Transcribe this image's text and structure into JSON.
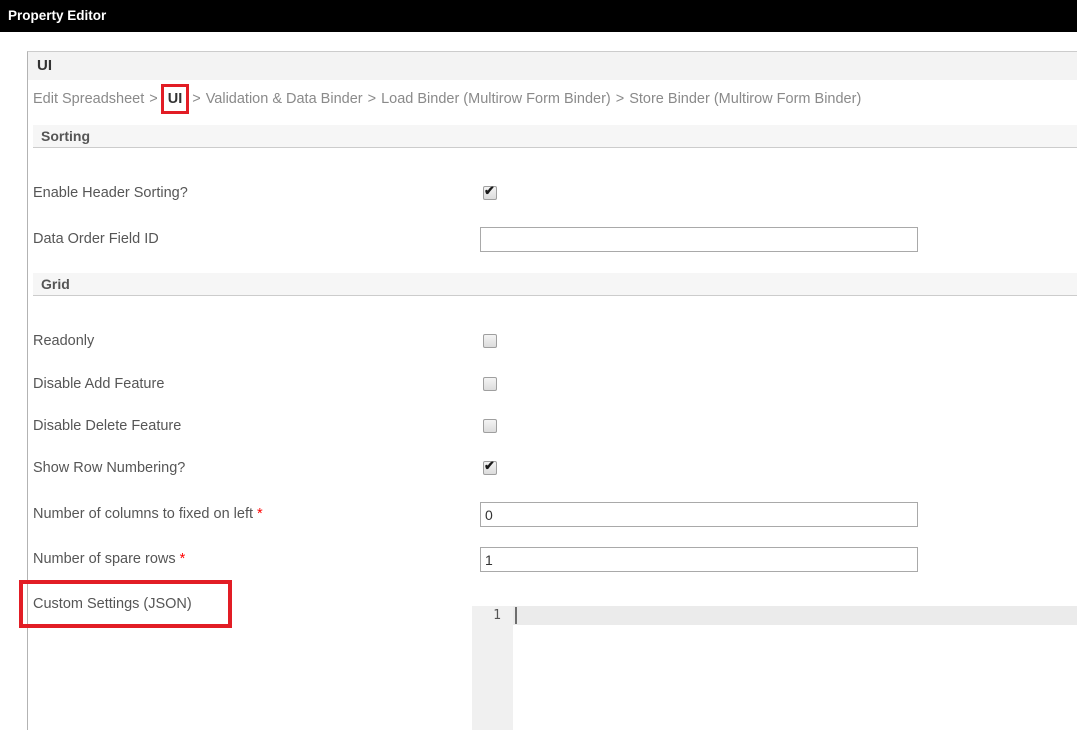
{
  "colors": {
    "titlebar_bg": "#000000",
    "titlebar_text": "#ffffff",
    "annotation_red": "#e21d25",
    "section_band_bg": "#f6f6f6",
    "panel_header_bg": "#f3f3f3",
    "label_text": "#565656",
    "breadcrumb_text": "#8a8a8a",
    "required_marker_red": "#ff0000",
    "editor_gutter_bg": "#f0f0f0",
    "editor_activeline_bg": "#ebebeb"
  },
  "titlebar": {
    "title": "Property Editor"
  },
  "panel": {
    "title": "UI"
  },
  "breadcrumb": {
    "separator": ">",
    "items": [
      "Edit Spreadsheet",
      "UI",
      "Validation & Data Binder",
      "Load Binder (Multirow Form Binder)",
      "Store Binder (Multirow Form Binder)"
    ],
    "current": "UI"
  },
  "form": {
    "required_marker": "*",
    "sections": [
      {
        "title": "Sorting"
      },
      {
        "title": "Grid"
      }
    ],
    "rows": [
      {
        "label": "Enable Header Sorting?",
        "type": "checkbox",
        "checked": true
      },
      {
        "label": "Data Order Field ID",
        "type": "text",
        "value": ""
      },
      {
        "label": "Readonly",
        "type": "checkbox",
        "checked": false
      },
      {
        "label": "Disable Add Feature",
        "type": "checkbox",
        "checked": false
      },
      {
        "label": "Disable Delete Feature",
        "type": "checkbox",
        "checked": false
      },
      {
        "label": "Show Row Numbering?",
        "type": "checkbox",
        "checked": true
      },
      {
        "label": "Number of columns to fixed on left",
        "required": true,
        "type": "text",
        "value": "0"
      },
      {
        "label": "Number of spare rows",
        "required": true,
        "type": "text",
        "value": "1"
      },
      {
        "label": "Custom Settings (JSON)",
        "type": "code_editor",
        "value": "",
        "line_number": "1"
      }
    ]
  }
}
